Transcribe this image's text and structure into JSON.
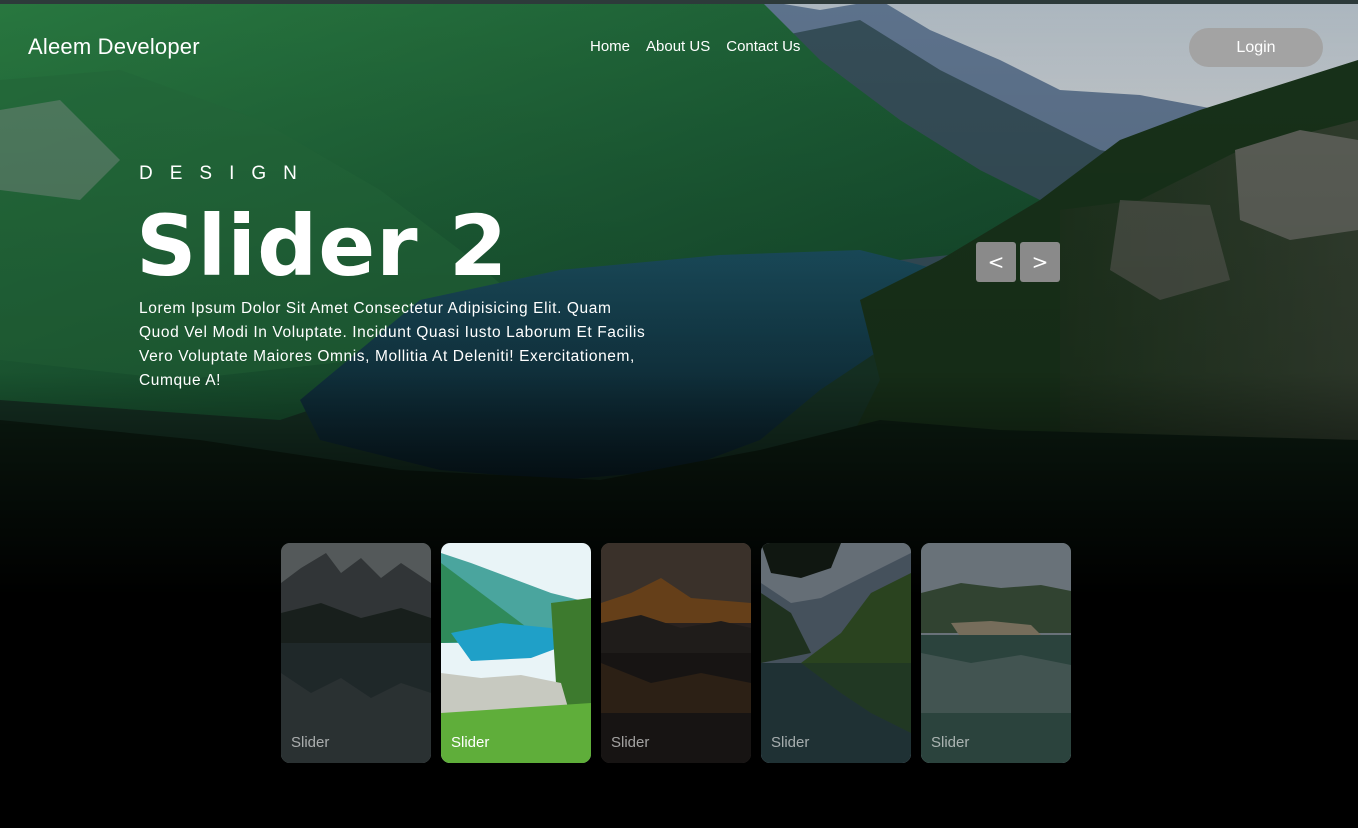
{
  "header": {
    "brand": "Aleem Developer",
    "nav": [
      {
        "label": "Home"
      },
      {
        "label": "About US"
      },
      {
        "label": "Contact Us"
      }
    ],
    "login_label": "Login"
  },
  "hero": {
    "eyebrow": "DESIGN",
    "title": "Slider 2",
    "description": "Lorem Ipsum Dolor Sit Amet Consectetur Adipisicing Elit. Quam Quod Vel Modi In Voluptate. Incidunt Quasi Iusto Laborum Et Facilis Vero Voluptate Maiores Omnis, Mollitia At Deleniti! Exercitationem, Cumque A!"
  },
  "controls": {
    "prev_label": "<",
    "next_label": ">"
  },
  "thumbnails": [
    {
      "caption": "Slider",
      "active": false
    },
    {
      "caption": "Slider",
      "active": true
    },
    {
      "caption": "Slider",
      "active": false
    },
    {
      "caption": "Slider",
      "active": false
    },
    {
      "caption": "Slider",
      "active": false
    }
  ],
  "colors": {
    "page_background": "#000000",
    "login_button": "#a3a3a3",
    "arrow_button": "#8a8a8a",
    "text": "#ffffff"
  },
  "icons": {
    "prev": "chevron-left-icon",
    "next": "chevron-right-icon"
  }
}
